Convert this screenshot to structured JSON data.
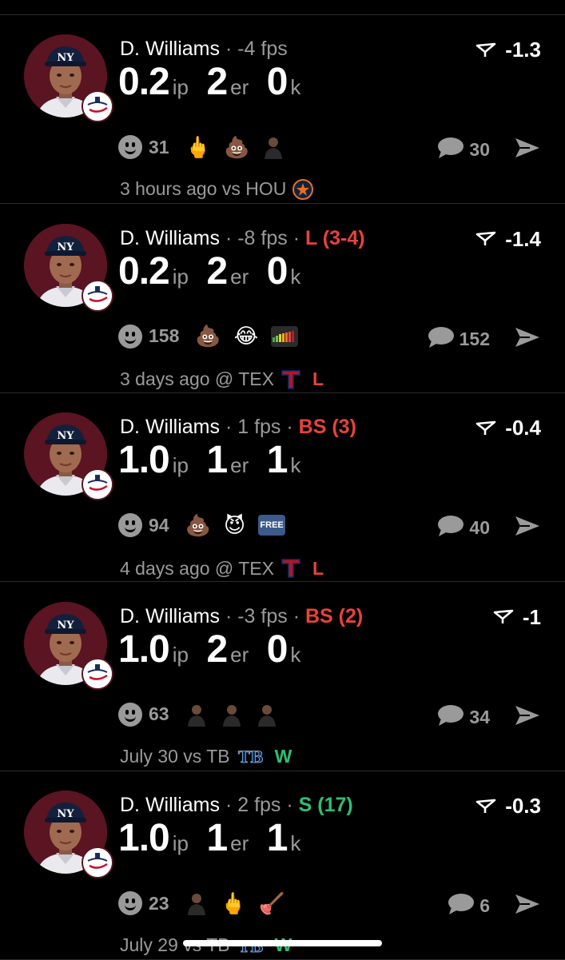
{
  "colors": {
    "background": "#000000",
    "muted": "#9a9a9a",
    "loss": "#e8423c",
    "win": "#2fbf71",
    "avatar_bg": "#5a1422"
  },
  "posts": [
    {
      "player": "D. Williams",
      "sep": "·",
      "fps": "-4 fps",
      "decision": "",
      "decision_color": "",
      "score": "-1.3",
      "ip": "0.2",
      "ip_label": "ip",
      "er": "2",
      "er_label": "er",
      "k": "0",
      "k_label": "k",
      "reaction_count": "31",
      "reactions": [
        "middle-finger-emoji",
        "poop-emoji",
        "person-sticker"
      ],
      "comment_count": "30",
      "time": "3 hours ago",
      "vs": "vs HOU",
      "opponent_logo": "astros-logo",
      "result": "",
      "result_color": ""
    },
    {
      "player": "D. Williams",
      "sep": "·",
      "fps": "-8 fps",
      "decision": "L (3-4)",
      "decision_color": "red",
      "score": "-1.4",
      "ip": "0.2",
      "ip_label": "ip",
      "er": "2",
      "er_label": "er",
      "k": "0",
      "k_label": "k",
      "reaction_count": "158",
      "reactions": [
        "poop-emoji",
        "laughing-tears-emoji",
        "sticker-chip"
      ],
      "comment_count": "152",
      "time": "3 days ago",
      "vs": "@ TEX",
      "opponent_logo": "rangers-logo",
      "result": "L",
      "result_color": "red"
    },
    {
      "player": "D. Williams",
      "sep": "·",
      "fps": "1 fps",
      "decision": "BS (3)",
      "decision_color": "red",
      "score": "-0.4",
      "ip": "1.0",
      "ip_label": "ip",
      "er": "1",
      "er_label": "er",
      "k": "1",
      "k_label": "k",
      "reaction_count": "94",
      "reactions": [
        "poop-emoji",
        "devil-emoji",
        "free-chip"
      ],
      "comment_count": "40",
      "time": "4 days ago",
      "vs": "@ TEX",
      "opponent_logo": "rangers-logo",
      "result": "L",
      "result_color": "red"
    },
    {
      "player": "D. Williams",
      "sep": "·",
      "fps": "-3 fps",
      "decision": "BS (2)",
      "decision_color": "red",
      "score": "-1",
      "ip": "1.0",
      "ip_label": "ip",
      "er": "2",
      "er_label": "er",
      "k": "0",
      "k_label": "k",
      "reaction_count": "63",
      "reactions": [
        "person-sticker",
        "person-sticker",
        "person-sticker"
      ],
      "comment_count": "34",
      "time": "July 30",
      "vs": "vs TB",
      "opponent_logo": "rays-logo",
      "result": "W",
      "result_color": "green"
    },
    {
      "player": "D. Williams",
      "sep": "·",
      "fps": "2 fps",
      "decision": "S (17)",
      "decision_color": "green",
      "score": "-0.3",
      "ip": "1.0",
      "ip_label": "ip",
      "er": "1",
      "er_label": "er",
      "k": "1",
      "k_label": "k",
      "reaction_count": "23",
      "reactions": [
        "person-sticker",
        "middle-finger-emoji",
        "broom-emoji"
      ],
      "comment_count": "6",
      "time": "July 29",
      "vs": "vs TB",
      "opponent_logo": "rays-logo",
      "result": "W",
      "result_color": "green"
    }
  ]
}
